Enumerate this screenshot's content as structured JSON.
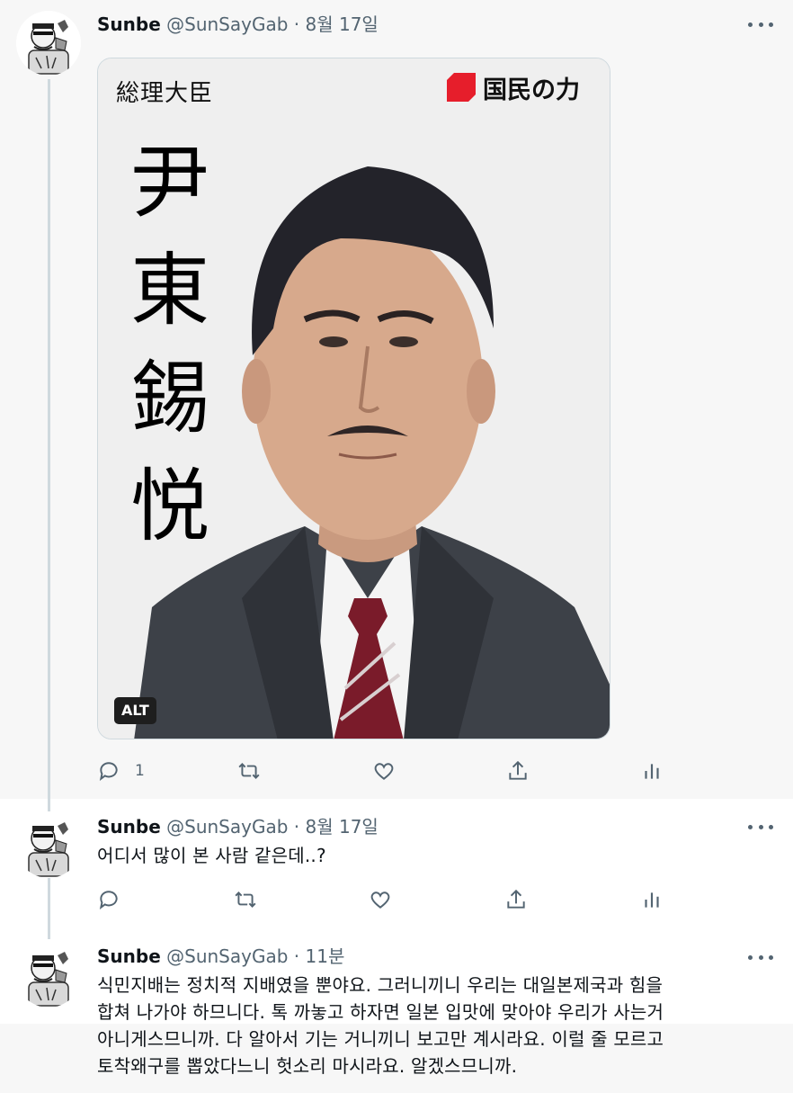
{
  "tweets": [
    {
      "author": {
        "name": "Sunbe",
        "handle": "@SunSayGab"
      },
      "separator": "·",
      "time": "8월 17일",
      "media": {
        "title": "総理大臣",
        "party": "国民の力",
        "vertical_name": [
          "尹",
          "東",
          "錫",
          "悦"
        ],
        "alt_badge": "ALT"
      },
      "actions": {
        "reply_count": "1"
      }
    },
    {
      "author": {
        "name": "Sunbe",
        "handle": "@SunSayGab"
      },
      "separator": "·",
      "time": "8월 17일",
      "text": "어디서 많이 본 사람 같은데..?"
    },
    {
      "author": {
        "name": "Sunbe",
        "handle": "@SunSayGab"
      },
      "separator": "·",
      "time": "11분",
      "text_lines": [
        "식민지배는 정치적 지배였을 뿐야요. 그러니끼니 우리는 대일본제국과 힘을",
        "합쳐 나가야 하므니다. 톡 까놓고 하자면 일본 입맛에 맞아야 우리가 사는거",
        "아니게스므니까. 다 알아서 기는 거니끼니 보고만 계시라요. 이럴 줄 모르고",
        "토착왜구를 뽑았다느니 헛소리 마시라요. 알겠스므니까."
      ]
    }
  ],
  "colors": {
    "text_primary": "#0f1419",
    "text_secondary": "#536471",
    "party_red": "#e61e2b",
    "thread_line": "#cfd9de"
  }
}
